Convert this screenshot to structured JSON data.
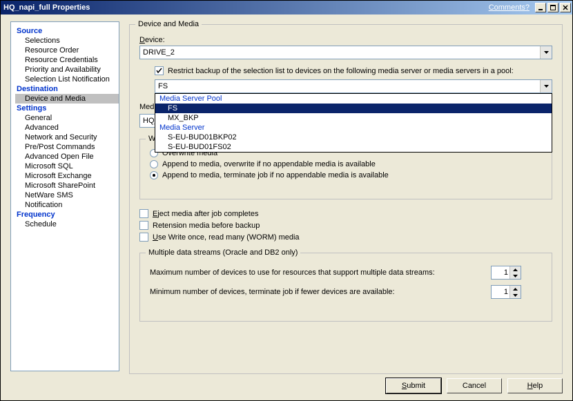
{
  "titlebar": {
    "title": "HQ_napi_full Properties",
    "comments": "Comments?"
  },
  "nav": {
    "categories": [
      {
        "label": "Source",
        "items": [
          "Selections",
          "Resource Order",
          "Resource Credentials",
          "Priority and Availability",
          "Selection List Notification"
        ]
      },
      {
        "label": "Destination",
        "items": [
          "Device and Media"
        ],
        "selected": 0
      },
      {
        "label": "Settings",
        "items": [
          "General",
          "Advanced",
          "Network and Security",
          "Pre/Post Commands",
          "Advanced Open File",
          "Microsoft SQL",
          "Microsoft Exchange",
          "Microsoft SharePoint",
          "NetWare SMS",
          "Notification"
        ]
      },
      {
        "label": "Frequency",
        "items": [
          "Schedule"
        ]
      }
    ]
  },
  "main": {
    "group_title": "Device and Media",
    "device_label": "Device:",
    "device_value": "DRIVE_2",
    "restrict_checked": true,
    "restrict_label": "Restrict backup of the selection list to devices on the following media server or media servers in a pool:",
    "restrict_value": "FS",
    "restrict_dropdown": {
      "groups": [
        {
          "label": "Media Server Pool",
          "items": [
            "FS",
            "MX_BKP"
          ],
          "selected": 0
        },
        {
          "label": "Media Server",
          "items": [
            "S-EU-BUD01BKP02",
            "S-EU-BUD01FS02"
          ]
        }
      ]
    },
    "media_set_label": "Media set:",
    "media_set_value": "HQ_",
    "when_group": "When this job begins",
    "radios": [
      "Overwrite media",
      "Append to media, overwrite if no appendable media is available",
      "Append to media, terminate job if no appendable media is available"
    ],
    "radio_selected": 2,
    "eject_label": "Eject media after job completes",
    "retension_label": "Retension media before backup",
    "worm_label": "Use Write once, read many (WORM) media",
    "streams_group": "Multiple data streams (Oracle and DB2 only)",
    "max_devices_label": "Maximum number of devices to use for resources that support multiple data streams:",
    "max_devices_value": "1",
    "min_devices_label": "Minimum number of devices, terminate job if fewer devices are available:",
    "min_devices_value": "1"
  },
  "buttons": {
    "submit": "Submit",
    "cancel": "Cancel",
    "help": "Help"
  }
}
